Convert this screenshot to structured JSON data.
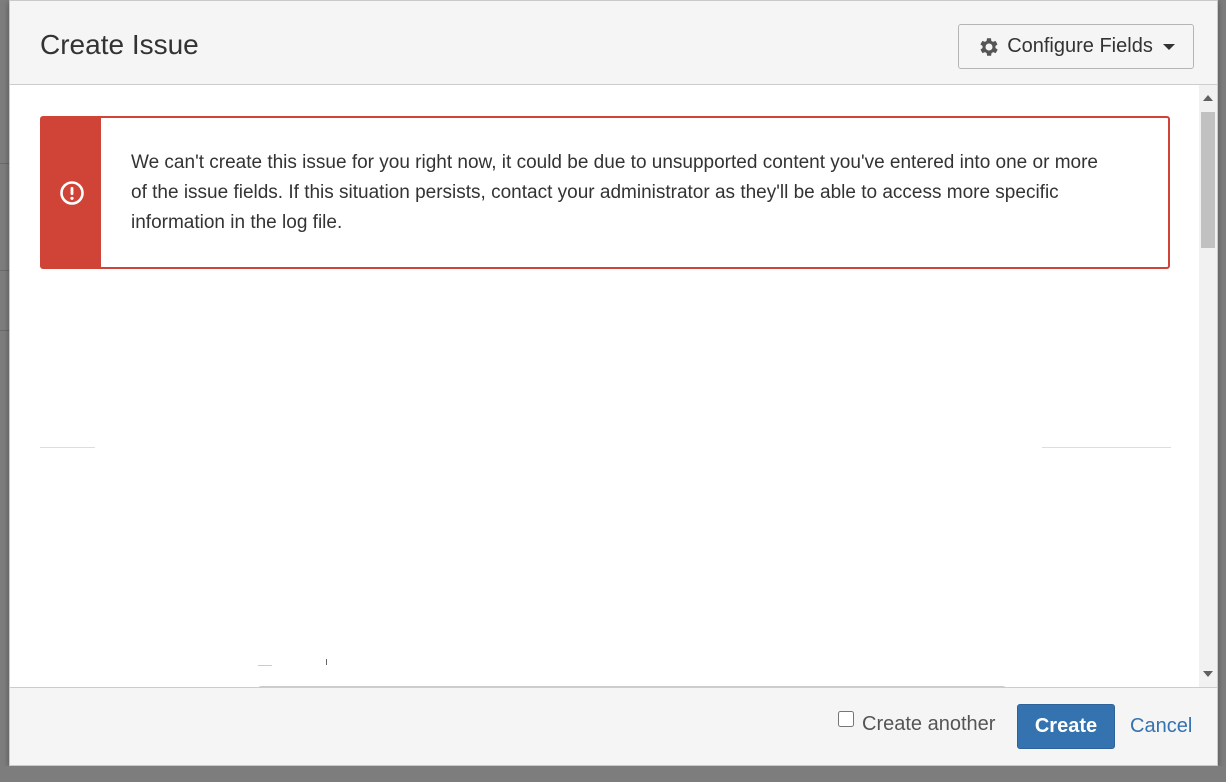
{
  "dialog": {
    "title": "Create Issue",
    "configure_label": "Configure Fields"
  },
  "error": {
    "message": "We can't create this issue for you right now, it could be due to unsupported content you've entered into one or more of the issue fields. If this situation persists, contact your administrator as they'll be able to access more specific information in the log file.",
    "color": "#d04437"
  },
  "footer": {
    "create_another_label": "Create another",
    "create_another_checked": false,
    "create_label": "Create",
    "cancel_label": "Cancel"
  },
  "icons": {
    "configure": "gear-icon",
    "configure_caret": "caret-down-icon",
    "error": "error-circle-icon"
  },
  "colors": {
    "primary": "#3572b0",
    "error": "#d04437",
    "header_bg": "#f5f5f5"
  }
}
